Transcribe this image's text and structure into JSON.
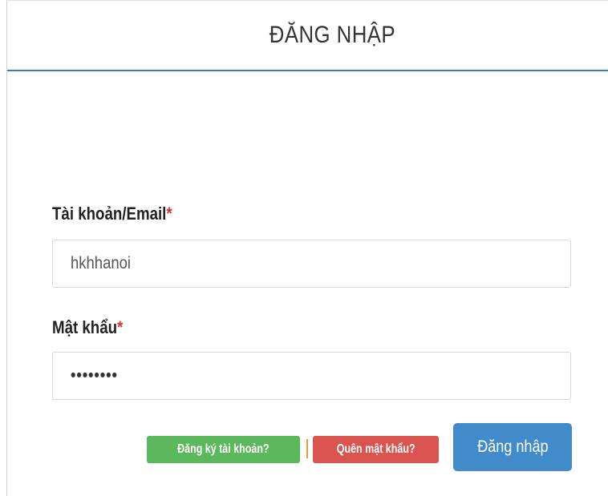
{
  "header": {
    "title": "ĐĂNG NHẬP"
  },
  "form": {
    "username": {
      "label": "Tài khoản/Email",
      "required_mark": "*",
      "value": "hkhhanoi"
    },
    "password": {
      "label": "Mật khẩu",
      "required_mark": "*",
      "value": "••••••••"
    }
  },
  "actions": {
    "register_label": "Đăng ký tài khoản?",
    "forgot_label": "Quên mật khẩu?",
    "login_label": "Đăng nhập"
  },
  "colors": {
    "header_rule": "#3a7cc4",
    "required": "#d9322b",
    "register_badge": "#5cb85c",
    "forgot_badge": "#d9534f",
    "login_button": "#428bca"
  }
}
